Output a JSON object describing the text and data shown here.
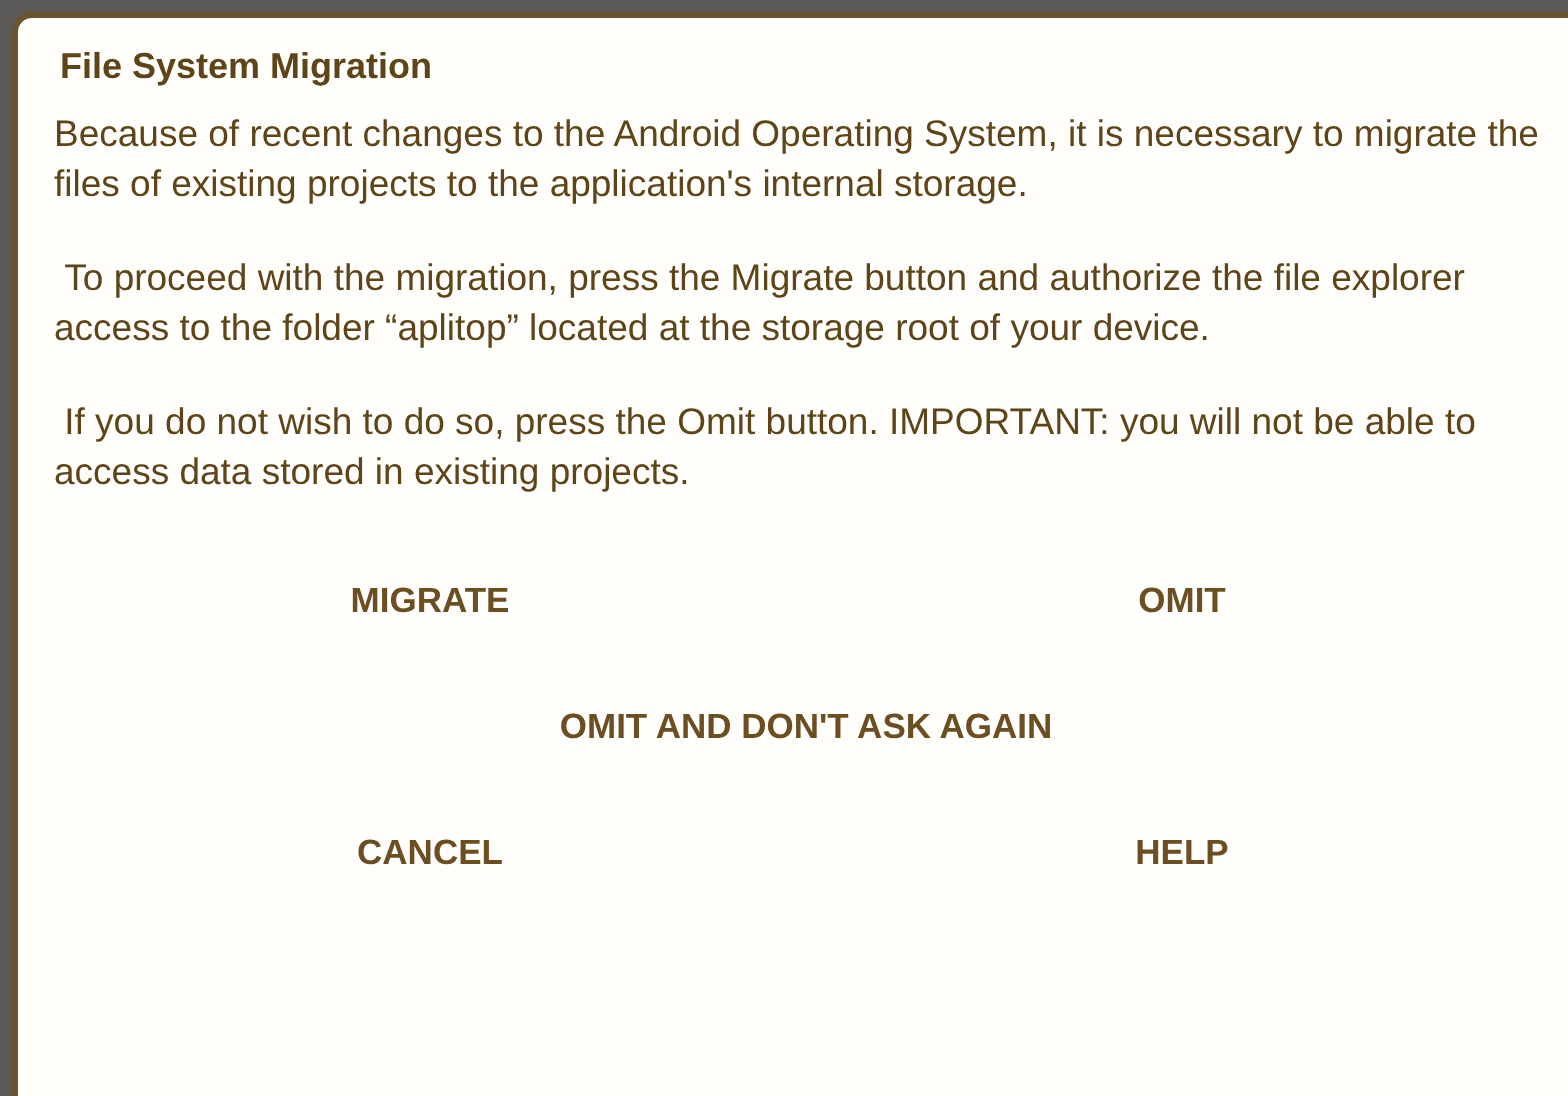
{
  "dialog": {
    "title": "File System Migration",
    "paragraphs": [
      "Because of recent changes to the Android Operating System, it is necessary to migrate the files of existing projects to the application's internal storage.",
      " To proceed with the migration, press the Migrate button and authorize the file explorer access to the folder “aplitop” located at the storage root of your device.",
      " If you do not wish to do so, press the Omit button. IMPORTANT: you will not be able to access data stored in existing projects."
    ],
    "button_rows": [
      [
        "MIGRATE",
        "OMIT"
      ],
      [
        "OMIT AND DON'T ASK AGAIN"
      ],
      [
        "CANCEL",
        "HELP"
      ]
    ]
  }
}
